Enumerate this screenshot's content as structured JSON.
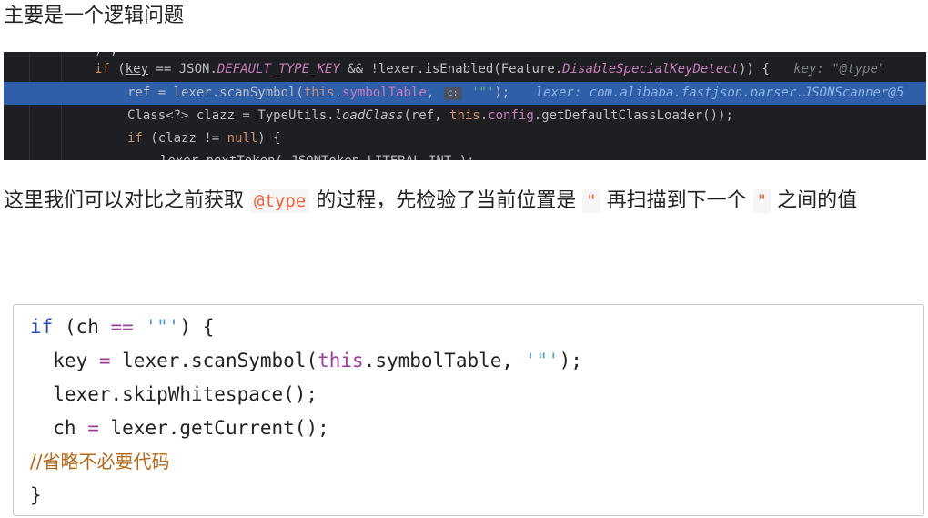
{
  "heading": "主要是一个逻辑问题",
  "ide": {
    "line0": {
      "kw_if": "if",
      "open": " (",
      "key": "key",
      "eq": " == JSON.",
      "const": "DEFAULT_TYPE_KEY",
      "and": " && !lexer.isEnabled(Feature.",
      "feature": "DisableSpecialKeyDetect",
      "close": ")) {",
      "hint": "key: \"@type\""
    },
    "line1": {
      "pre": "ref = lexer.scanSymbol(",
      "this": "this",
      "dot": ".",
      "field": "symbolTable",
      "comma": ", ",
      "badge": "c:",
      "str": " '\"'",
      "close": ");",
      "hint": "lexer: com.alibaba.fastjson.parser.JSONScanner@5"
    },
    "line2": {
      "pre": "Class<?> clazz = TypeUtils.",
      "method": "loadClass",
      "mid": "(ref, ",
      "this": "this",
      "dot": ".",
      "field": "config",
      "post": ".getDefaultClassLoader());"
    },
    "line3": {
      "kw_if": "if",
      "pre": " (clazz != ",
      "null": "null",
      "post": ") {"
    },
    "line4": {
      "text": "lexer.nextToken( JSONToken.LITERAL_INT );"
    }
  },
  "paragraph": {
    "part1": "这里我们可以对比之前获取 ",
    "code1": "@type",
    "part2": " 的过程，先检验了当前位置是 ",
    "code2": "\"",
    "part3": " 再扫描到下一个 ",
    "code3": "\"",
    "part4": " 之间的值"
  },
  "codeblock": {
    "l1_kw": "if",
    "l1_a": " (ch ",
    "l1_op": "==",
    "l1_b": " ",
    "l1_str": "'\"'",
    "l1_c": ") {",
    "l2_a": "  key ",
    "l2_op": "=",
    "l2_b": " lexer.scanSymbol(",
    "l2_this": "this",
    "l2_c": ".symbolTable, ",
    "l2_str": "'\"'",
    "l2_d": ");",
    "l3": "  lexer.skipWhitespace();",
    "l4_a": "  ch ",
    "l4_op": "=",
    "l4_b": " lexer.getCurrent();",
    "l5": "//省略不必要代码",
    "l6": "}"
  }
}
